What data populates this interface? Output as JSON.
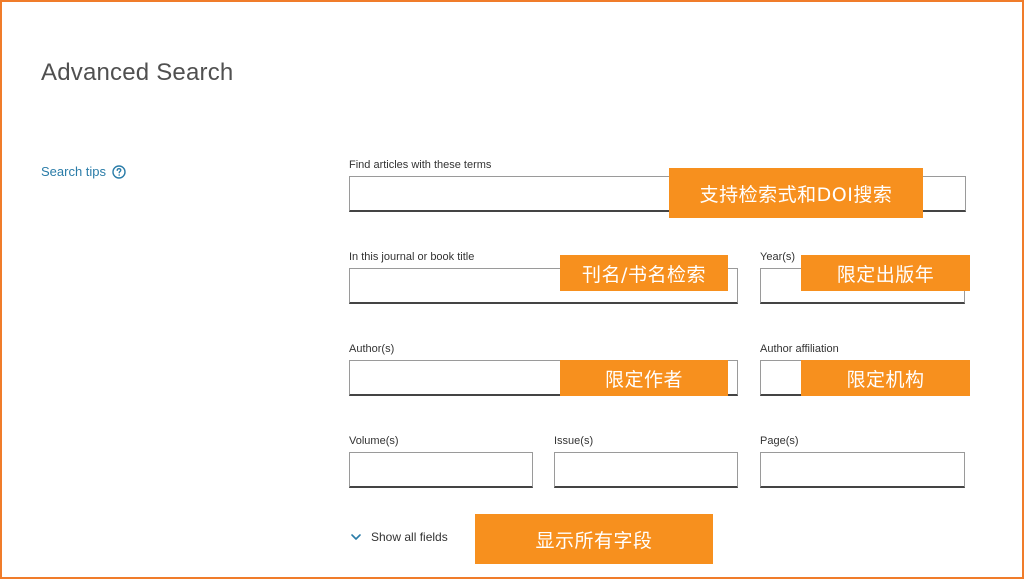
{
  "page": {
    "title": "Advanced Search"
  },
  "sidebar": {
    "search_tips_label": "Search tips"
  },
  "fields": {
    "terms": {
      "label": "Find articles with these terms",
      "value": ""
    },
    "journal": {
      "label": "In this journal or book title",
      "value": ""
    },
    "years": {
      "label": "Year(s)",
      "value": ""
    },
    "authors": {
      "label": "Author(s)",
      "value": ""
    },
    "affiliation": {
      "label": "Author affiliation",
      "value": ""
    },
    "volume": {
      "label": "Volume(s)",
      "value": ""
    },
    "issue": {
      "label": "Issue(s)",
      "value": ""
    },
    "pages": {
      "label": "Page(s)",
      "value": ""
    }
  },
  "show_all": {
    "label": "Show all fields"
  },
  "annotations": {
    "terms": "支持检索式和DOI搜索",
    "journal": "刊名/书名检索",
    "years": "限定出版年",
    "authors": "限定作者",
    "affiliation": "限定机构",
    "show_all": "显示所有字段"
  },
  "colors": {
    "frame_border": "#f07c2a",
    "annotation_bg": "#f7901e",
    "link": "#2a7ca8"
  },
  "icons": {
    "help": "help-circle-icon",
    "expand": "chevron-down-icon"
  }
}
